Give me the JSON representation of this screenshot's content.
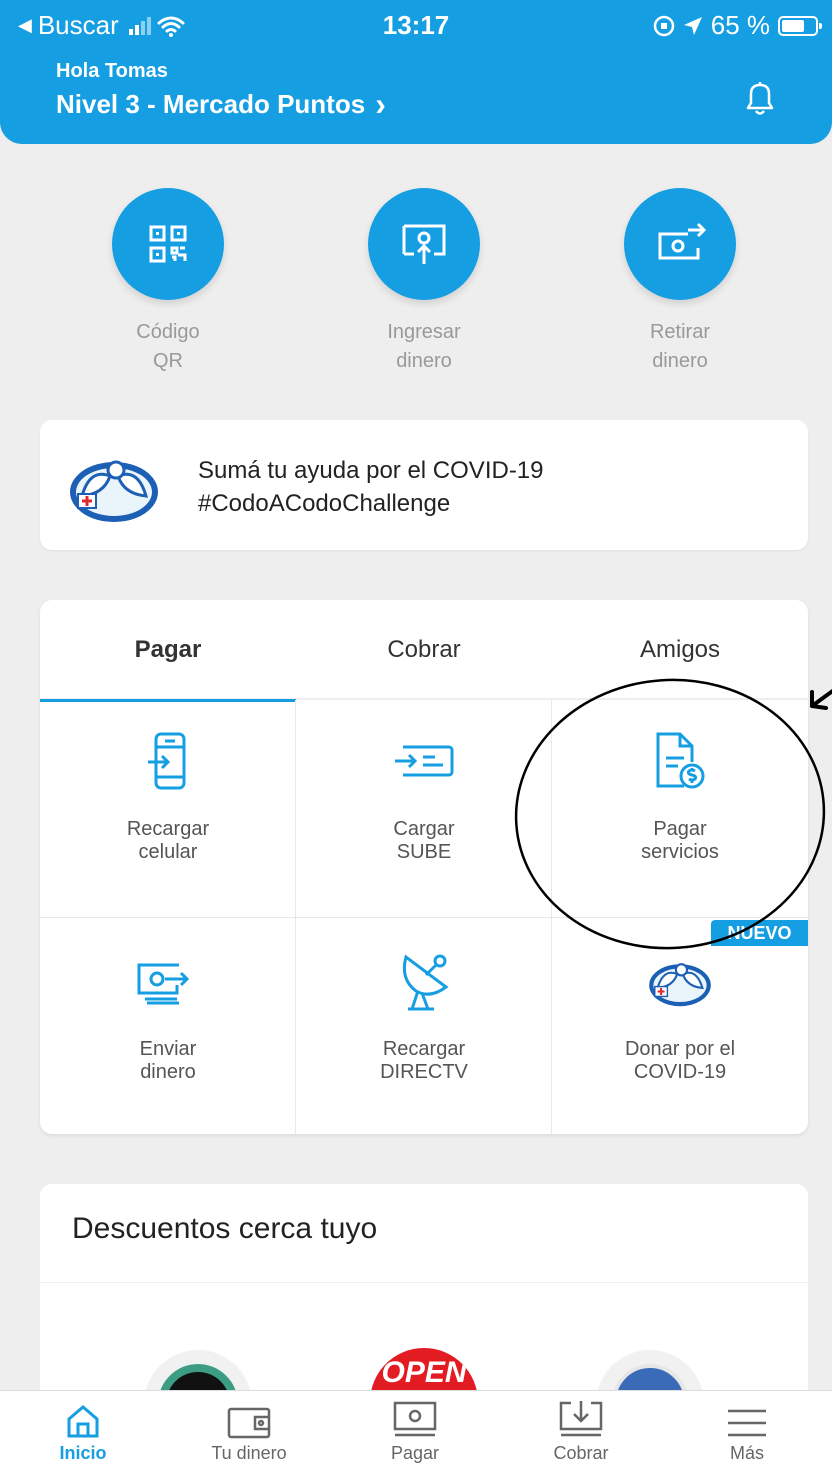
{
  "status_bar": {
    "back_label": "Buscar",
    "time": "13:17",
    "battery": "65 %"
  },
  "header": {
    "greeting": "Hola Tomas",
    "level": "Nivel 3 - Mercado Puntos",
    "chevron": "›"
  },
  "quick_actions": [
    {
      "line1": "Código",
      "line2": "QR",
      "icon": "qr-code-icon"
    },
    {
      "line1": "Ingresar",
      "line2": "dinero",
      "icon": "deposit-money-icon"
    },
    {
      "line1": "Retirar",
      "line2": "dinero",
      "icon": "withdraw-money-icon"
    }
  ],
  "banner": {
    "line1": "Sumá tu ayuda por el COVID-19",
    "line2": "#CodoACodoChallenge"
  },
  "tabs": [
    {
      "label": "Pagar"
    },
    {
      "label": "Cobrar"
    },
    {
      "label": "Amigos"
    }
  ],
  "actions": [
    {
      "line1": "Recargar",
      "line2": "celular",
      "icon": "phone-recharge-icon"
    },
    {
      "line1": "Cargar",
      "line2": "SUBE",
      "icon": "sube-card-icon"
    },
    {
      "line1": "Pagar",
      "line2": "servicios",
      "icon": "bill-payment-icon"
    },
    {
      "line1": "Enviar",
      "line2": "dinero",
      "icon": "send-money-icon"
    },
    {
      "line1": "Recargar",
      "line2": "DIRECTV",
      "icon": "satellite-dish-icon"
    },
    {
      "line1": "Donar por el",
      "line2": "COVID-19",
      "icon": "donation-mascot-icon"
    }
  ],
  "badge": "NUEVO",
  "discounts": {
    "title": "Descuentos cerca tuyo",
    "logo_text": "OPEN"
  },
  "bottom_nav": [
    {
      "label": "Inicio",
      "icon": "home-icon"
    },
    {
      "label": "Tu dinero",
      "icon": "wallet-icon"
    },
    {
      "label": "Pagar",
      "icon": "pay-icon"
    },
    {
      "label": "Cobrar",
      "icon": "collect-icon"
    },
    {
      "label": "Más",
      "icon": "menu-icon"
    }
  ],
  "colors": {
    "primary": "#169ee3",
    "background": "#eeeeee",
    "annotation": "#000000"
  }
}
